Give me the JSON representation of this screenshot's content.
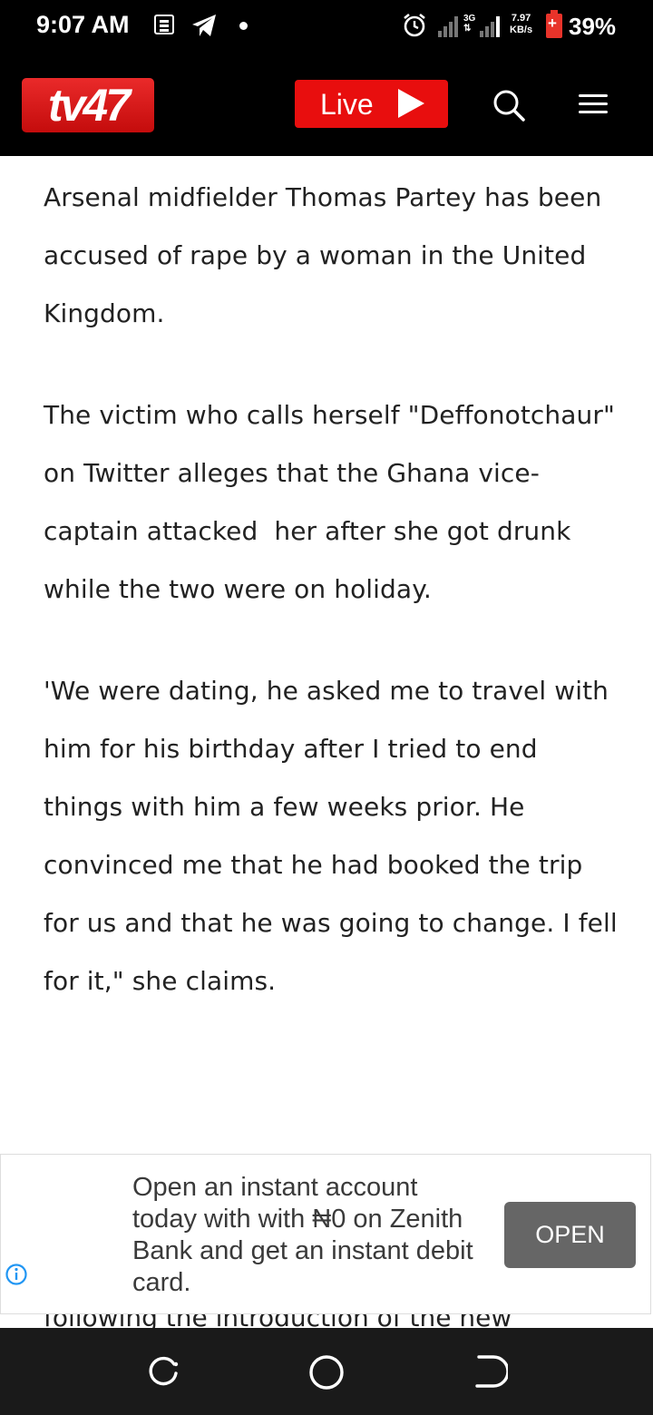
{
  "status_bar": {
    "time": "9:07 AM",
    "network_type": "3G",
    "speed_value": "7.97",
    "speed_unit": "KB/s",
    "battery": "39%",
    "icons": [
      "news-icon",
      "telegram-icon",
      "notification-dot",
      "alarm-icon",
      "signal-icon",
      "battery-icon"
    ]
  },
  "header": {
    "logo_text": "tv47",
    "live_label": "Live",
    "brand_color": "#e80e0e",
    "icons": [
      "play-icon",
      "search-icon",
      "menu-icon"
    ]
  },
  "article": {
    "paragraphs": [
      "Arsenal midfielder Thomas Partey has been accused of rape by a woman in the United Kingdom.",
      "The victim who calls herself \"Deffonotchaur\" on Twitter alleges that the Ghana vice-captain attacked  her after she got drunk while the two were on holiday.",
      "'We were dating, he asked me to travel with him for his birthday after I tried to end things with him a few weeks prior. He convinced me that he had booked the trip for us and that he was going to change. I fell for it,\" she claims."
    ],
    "cut_off_line": "following the introduction of the new"
  },
  "ad": {
    "text": "Open an instant account today with with ₦0 on Zenith Bank and get an instant debit card.",
    "button_label": "OPEN",
    "info_icon": "info-icon",
    "accent": "#2196f3"
  },
  "nav_bar": {
    "icons": [
      "recent-apps-icon",
      "home-icon",
      "back-icon"
    ]
  }
}
